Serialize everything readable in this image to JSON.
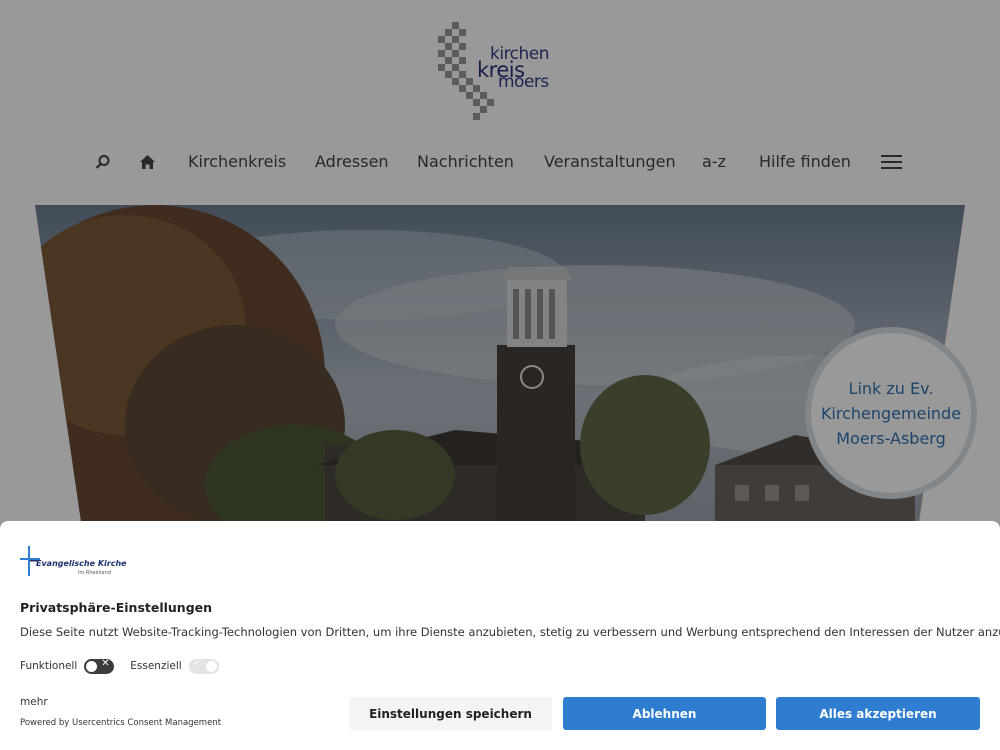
{
  "logo": {
    "line1": "kirchen",
    "line2": "kreis",
    "line3": "moers"
  },
  "nav": {
    "items": [
      "Kirchenkreis",
      "Adressen",
      "Nachrichten",
      "Veranstaltungen",
      "a-z",
      "Hilfe finden"
    ],
    "icons": [
      "search-icon",
      "home-icon",
      "menu-icon"
    ]
  },
  "hero": {
    "link_text": "Link zu Ev.\nKirchengemeinde\nMoers-Asberg"
  },
  "consent": {
    "logo_text": "Evangelische Kirche",
    "logo_subtext": "im Rheinland",
    "title": "Privatsphäre-Einstellungen",
    "description": "Diese Seite nutzt Website-Tracking-Technologien von Dritten, um ihre Dienste anzubieten, stetig zu verbessern und Werbung entsprechend den Interessen der Nutzer anzuzeigen.",
    "toggles": [
      {
        "label": "Funktionell",
        "state": "on"
      },
      {
        "label": "Essenziell",
        "state": "locked"
      }
    ],
    "more_link": "mehr",
    "powered_by": "Powered by Usercentrics Consent Management",
    "buttons": {
      "save": "Einstellungen speichern",
      "deny": "Ablehnen",
      "accept": "Alles akzeptieren"
    }
  },
  "colors": {
    "accent_blue": "#2f7dd1",
    "link_blue": "#2e74b5",
    "logo_blue": "#2f3f8a"
  }
}
